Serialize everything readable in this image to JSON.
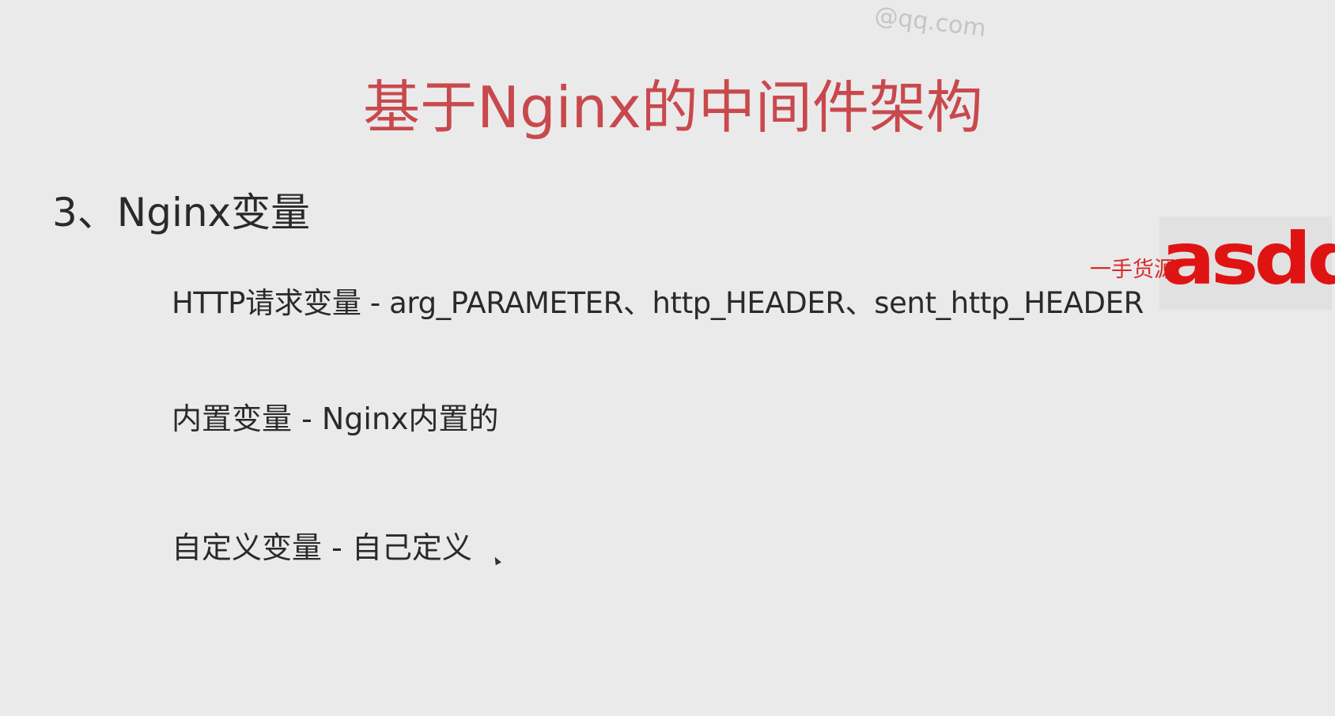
{
  "watermark": {
    "top_text": "@qq.com"
  },
  "slide": {
    "title": "基于Nginx的中间件架构",
    "section_heading": "3、Nginx变量",
    "bullets": [
      "HTTP请求变量 - arg_PARAMETER、http_HEADER、sent_http_HEADER",
      "内置变量 - Nginx内置的",
      "自定义变量  -  自己定义"
    ]
  },
  "overlay": {
    "stamp_text": "asdd",
    "note_text": "一手货源"
  },
  "colors": {
    "background": "#ebeaeb",
    "title": "#c8494d",
    "body_text": "#2a2a2a",
    "stamp": "#e01313"
  },
  "icons": {
    "cursor": "mouse-cursor-icon"
  }
}
